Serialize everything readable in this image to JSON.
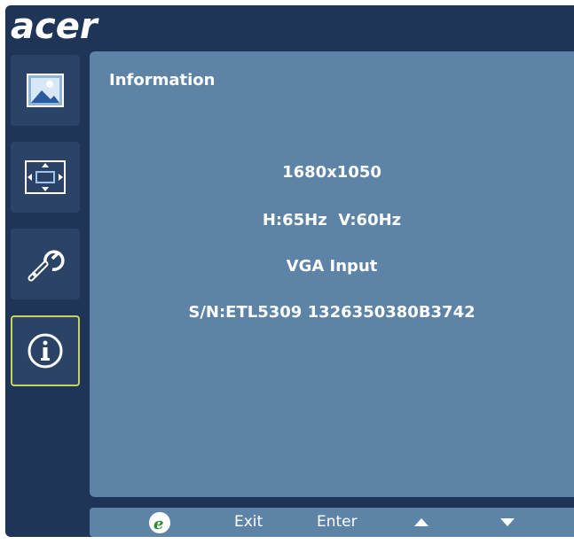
{
  "brand": {
    "logo_text": "acer"
  },
  "sidebar": {
    "items": [
      {
        "name": "picture",
        "icon": "picture-icon",
        "active": false
      },
      {
        "name": "display",
        "icon": "display-position-icon",
        "active": false
      },
      {
        "name": "setup",
        "icon": "wrench-icon",
        "active": false
      },
      {
        "name": "information",
        "icon": "info-icon",
        "active": true
      }
    ]
  },
  "panel": {
    "title": "Information",
    "resolution": "1680x1050",
    "frequency": "H:65Hz  V:60Hz",
    "input": "VGA Input",
    "serial": "S/N:ETL5309 1326350380B3742"
  },
  "footer": {
    "empowering_icon": "e-icon",
    "exit_label": "Exit",
    "enter_label": "Enter",
    "up_icon": "up-arrow-icon",
    "down_icon": "down-arrow-icon"
  },
  "colors": {
    "background": "#1f3558",
    "panel": "#5d84a6",
    "active_border": "#c8d35a"
  }
}
